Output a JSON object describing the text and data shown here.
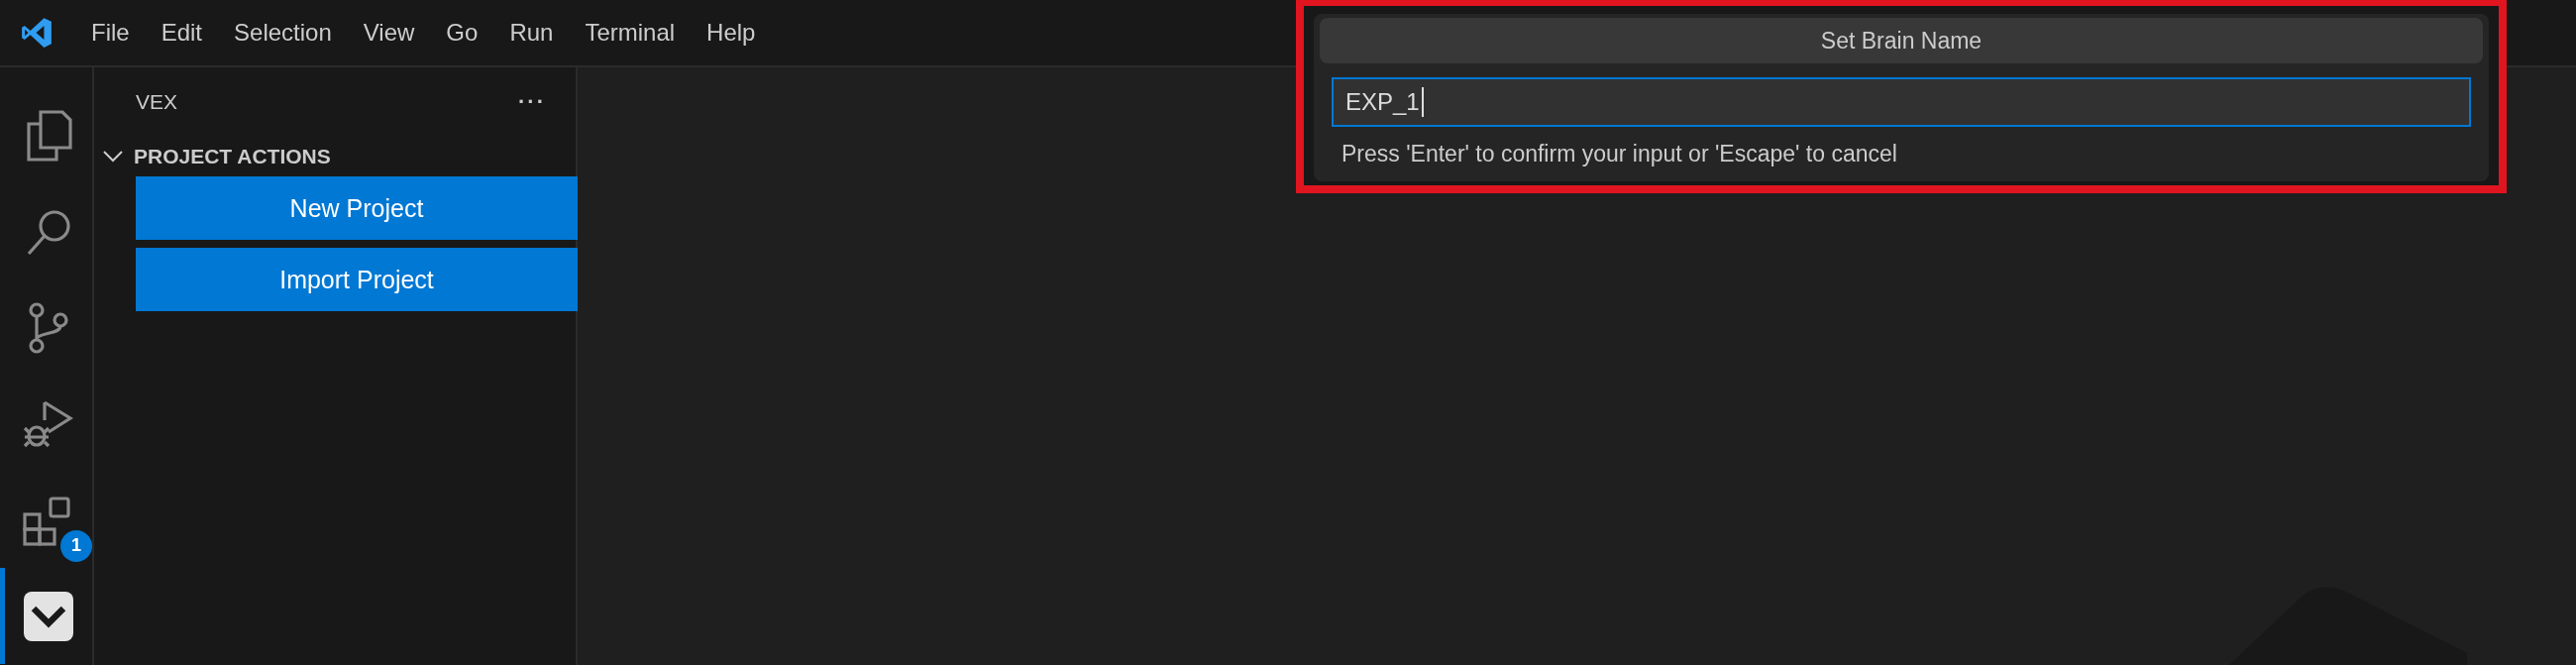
{
  "menu": [
    "File",
    "Edit",
    "Selection",
    "View",
    "Go",
    "Run",
    "Terminal",
    "Help"
  ],
  "activity_bar": [
    {
      "kind": "files",
      "selected": false
    },
    {
      "kind": "search",
      "selected": false
    },
    {
      "kind": "source-control",
      "selected": false
    },
    {
      "kind": "run-debug",
      "selected": false
    },
    {
      "kind": "extensions",
      "selected": false,
      "badge": "1"
    },
    {
      "kind": "vex",
      "selected": true
    }
  ],
  "sidebar": {
    "title": "VEX",
    "more": "···",
    "section": {
      "title": "PROJECT ACTIONS",
      "expanded": true,
      "buttons": [
        "New Project",
        "Import Project"
      ]
    }
  },
  "quick_input": {
    "title": "Set Brain Name",
    "value": "EXP_1",
    "hint": "Press 'Enter' to confirm your input or 'Escape' to cancel"
  }
}
